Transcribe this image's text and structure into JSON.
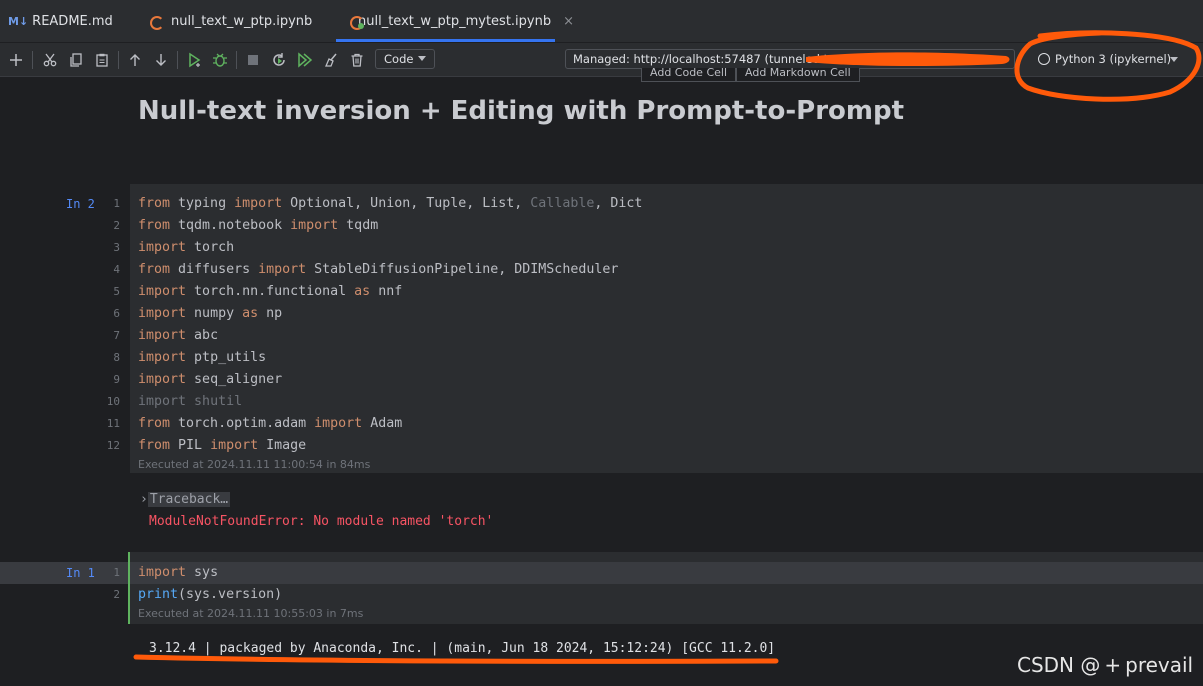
{
  "tabs": [
    {
      "label": "README.md",
      "badge": "M↓",
      "icon": "markdown-icon"
    },
    {
      "label": "null_text_w_ptp.ipynb",
      "icon": "jupyter-notebook-icon"
    },
    {
      "label": "null_text_w_ptp_mytest.ipynb",
      "icon": "jupyter-notebook-icon",
      "active": true,
      "close": "×"
    }
  ],
  "toolbar": {
    "icons": [
      "add-cell-icon",
      "cut-icon",
      "copy-icon",
      "paste-icon",
      "move-up-icon",
      "move-down-icon",
      "run-cell-icon",
      "debug-cell-icon",
      "stop-icon",
      "restart-kernel-icon",
      "run-all-icon",
      "clear-outputs-icon",
      "delete-cell-icon"
    ],
    "cell_type": "Code",
    "server": "Managed: http://localhost:57487 (tunneled t",
    "kernel": "Python 3 (ipykernel)"
  },
  "add_cell": {
    "code": "Add Code Cell",
    "markdown": "Add Markdown Cell"
  },
  "heading": "Null-text inversion + Editing with Prompt-to-Prompt",
  "cell1": {
    "prompt": "In 2",
    "executed": "Executed at 2024.11.11 11:00:54 in 84ms",
    "traceback_arrow": "›",
    "traceback": "Traceback…",
    "error": "ModuleNotFoundError: No module named 'torch'"
  },
  "cell2": {
    "prompt": "In 1",
    "executed": "Executed at 2024.11.11 10:55:03 in 7ms",
    "output": "3.12.4 | packaged by Anaconda, Inc. | (main, Jun 18 2024, 15:12:24) [GCC 11.2.0]"
  },
  "line_numbers": [
    "1",
    "2",
    "3",
    "4",
    "5",
    "6",
    "7",
    "8",
    "9",
    "10",
    "11",
    "12"
  ],
  "line_numbers2": [
    "1",
    "2"
  ],
  "code1": [
    {
      "a": "from",
      "b": " typing ",
      "c": "import",
      "d": " Optional, Union, Tuple, List, ",
      "e": "Callable",
      "f": ", Dict"
    },
    {
      "a": "from",
      "b": " tqdm.notebook ",
      "c": "import",
      "d": " tqdm"
    },
    {
      "a": "import",
      "b": " torch"
    },
    {
      "a": "from",
      "b": " diffusers ",
      "c": "import",
      "d": " StableDiffusionPipeline, DDIMScheduler"
    },
    {
      "a": "import",
      "b": " torch.nn.functional ",
      "c": "as",
      "d": " nnf"
    },
    {
      "a": "import",
      "b": " numpy ",
      "c": "as",
      "d": " np"
    },
    {
      "a": "import",
      "b": " abc"
    },
    {
      "a": "import",
      "b": " ptp_utils"
    },
    {
      "a": "import",
      "b": " seq_aligner"
    },
    {
      "a": "import",
      "b": " shutil"
    },
    {
      "a": "from",
      "b": " torch.optim.adam ",
      "c": "import",
      "d": " Adam"
    },
    {
      "a": "from",
      "b": " PIL ",
      "c": "import",
      "d": " Image"
    }
  ],
  "code2": [
    {
      "a": "import",
      "b": " sys"
    },
    {
      "a": "print",
      "b": "(sys.version)"
    }
  ],
  "watermark": "CSDN @ + prevail",
  "colors": {
    "annotation": "#ff5a0a",
    "accent": "#3574f0",
    "keyword": "#cf8e6d",
    "error": "#f75464"
  }
}
